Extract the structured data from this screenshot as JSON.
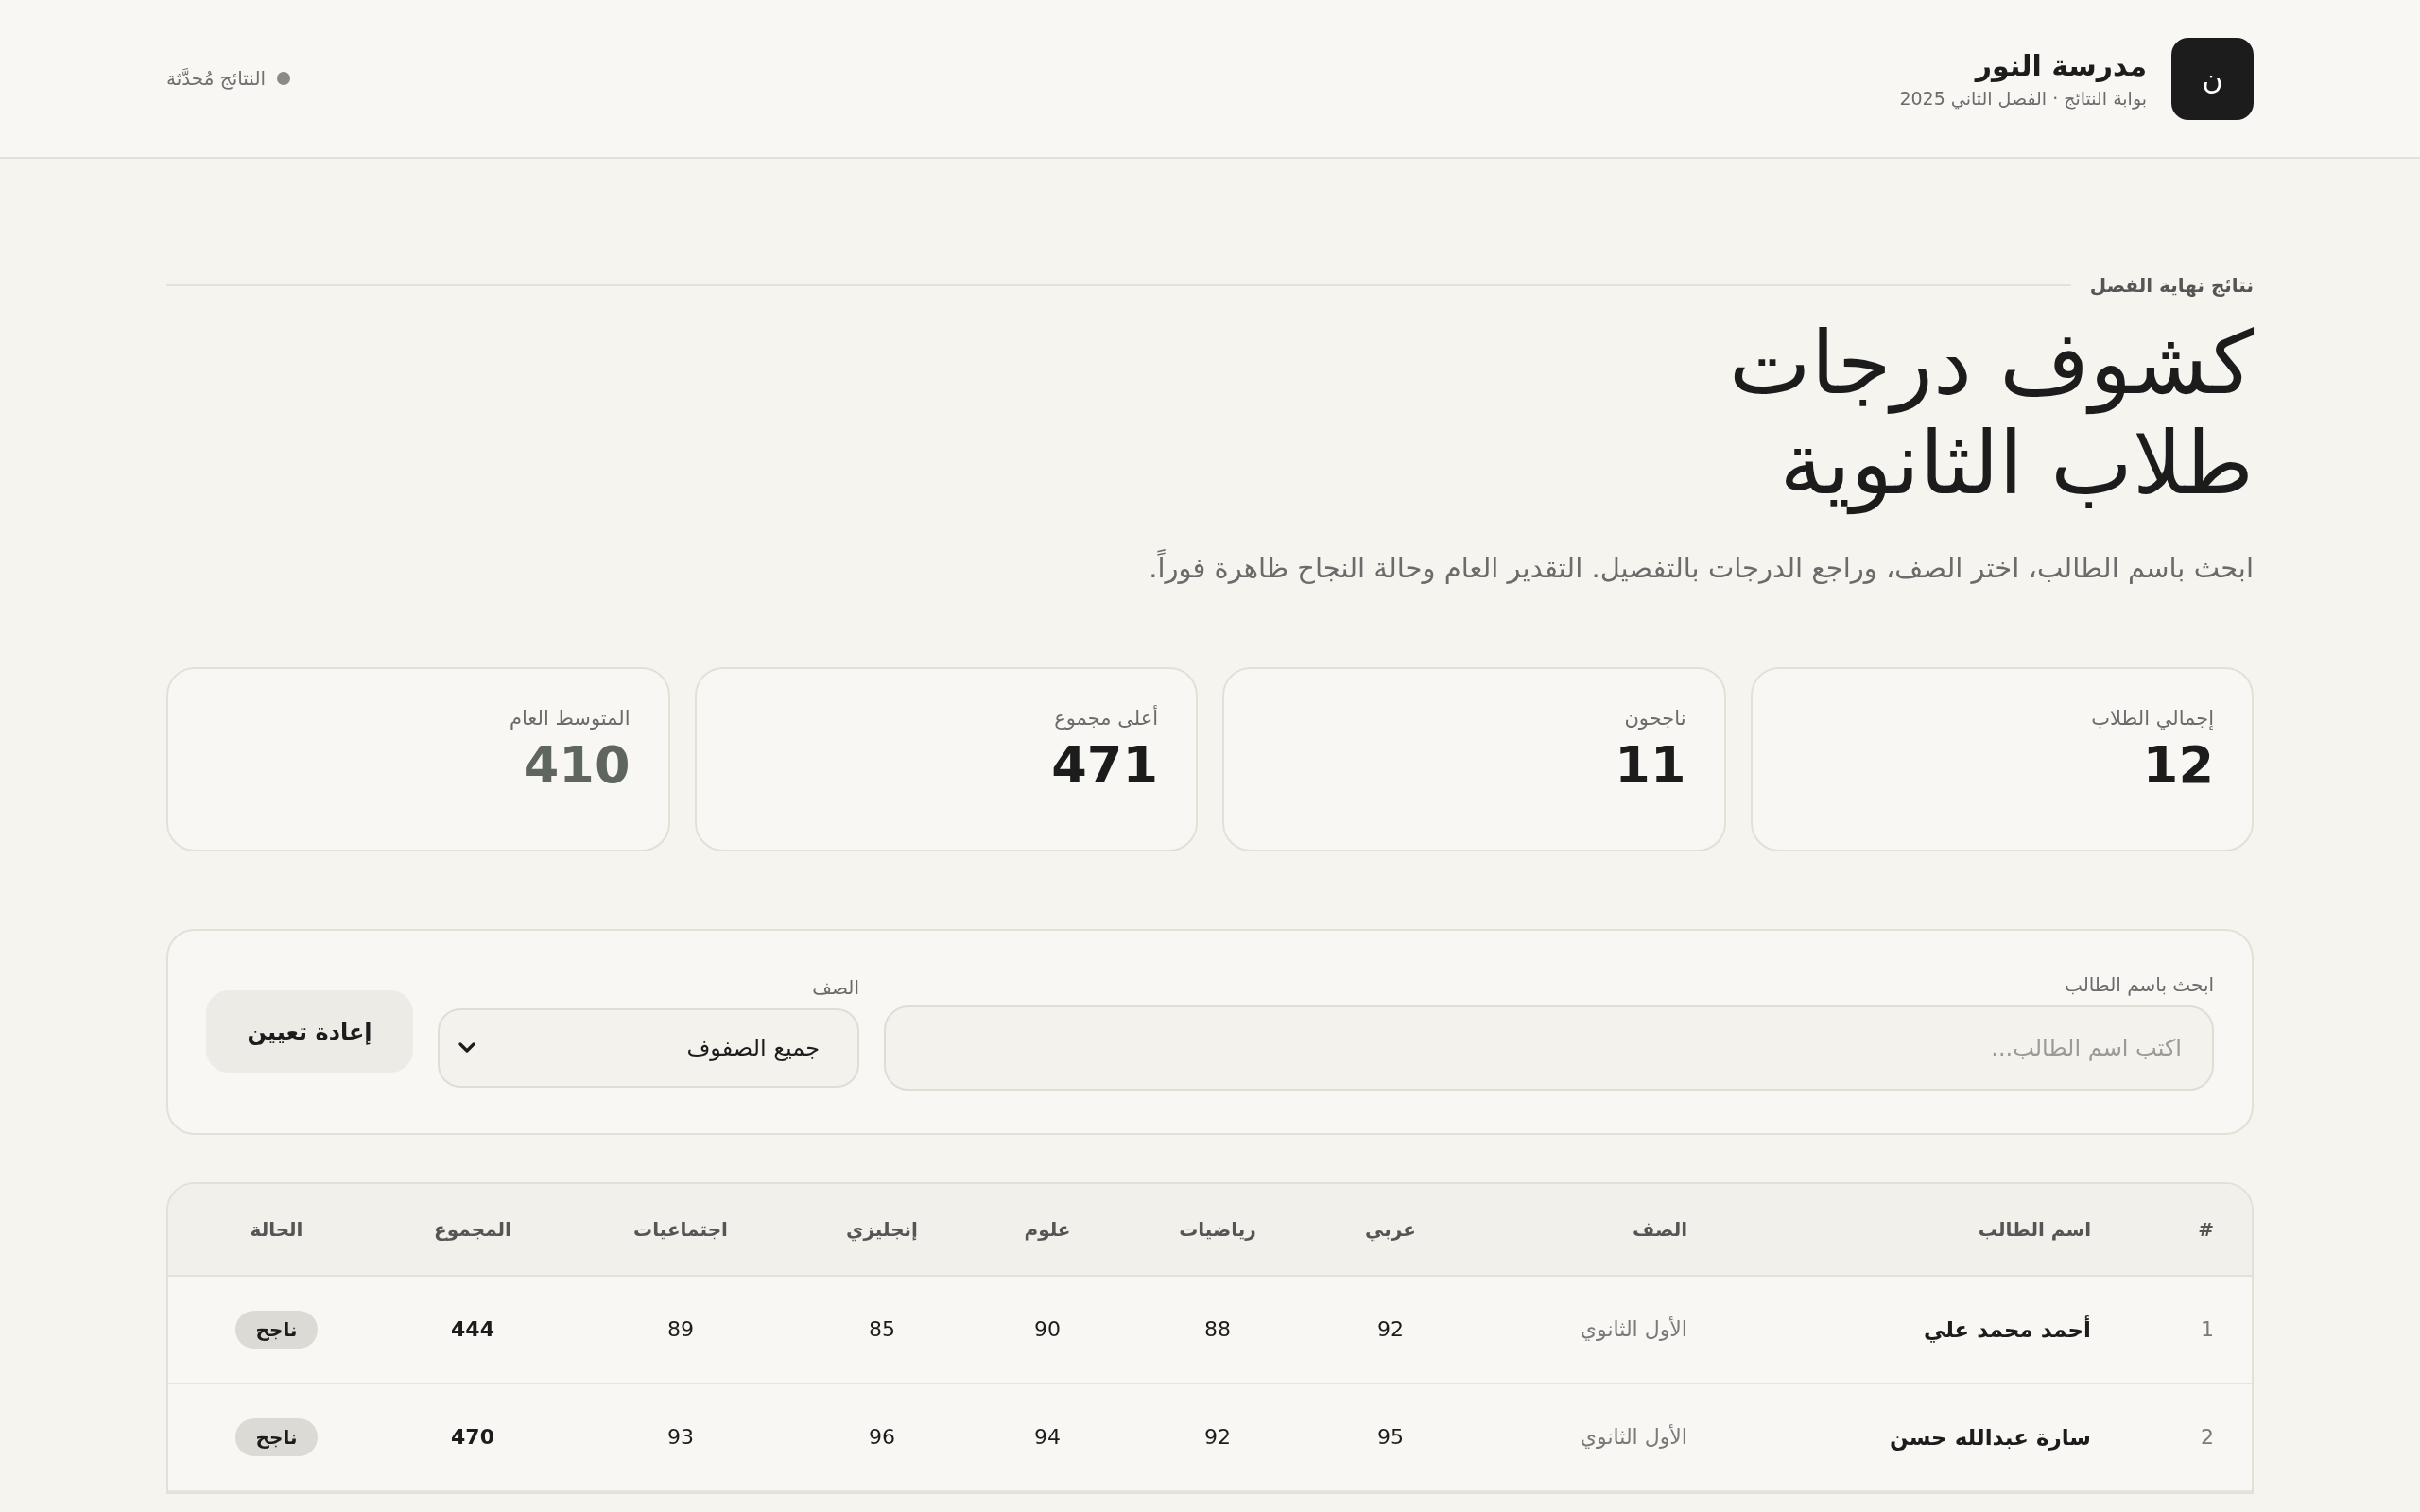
{
  "header": {
    "logo_letter": "ن",
    "school_name": "مدرسة النور",
    "subtitle": "بوابة النتائج · الفصل الثاني 2025",
    "status": "النتائج مُحدَّثة"
  },
  "hero": {
    "eyebrow": "نتائج نهاية الفصل",
    "title_lines": [
      "كشوف درجات",
      "طلاب الثانوية"
    ],
    "description": "ابحث باسم الطالب، اختر الصف، وراجع الدرجات بالتفصيل. التقدير العام وحالة النجاح ظاهرة فوراً."
  },
  "stats": [
    {
      "label": "إجمالي الطلاب",
      "value": "12",
      "color": "#1c1c1c"
    },
    {
      "label": "ناجحون",
      "value": "11",
      "color": "#1c1c1c"
    },
    {
      "label": "أعلى مجموع",
      "value": "471",
      "color": "#1c1c1c"
    },
    {
      "label": "المتوسط العام",
      "value": "410",
      "color": "#5f665f"
    }
  ],
  "filters": {
    "search": {
      "label": "ابحث باسم الطالب",
      "placeholder": "اكتب اسم الطالب..."
    },
    "class_select": {
      "label": "الصف",
      "value": "جميع الصفوف"
    },
    "reset_button": "إعادة تعيين"
  },
  "table": {
    "columns": [
      "#",
      "اسم الطالب",
      "الصف",
      "عربي",
      "رياضيات",
      "علوم",
      "إنجليزي",
      "اجتماعيات",
      "المجموع",
      "الحالة"
    ],
    "rows": [
      {
        "number": "1",
        "name": "أحمد محمد علي",
        "class": "الأول الثانوي",
        "scores": [
          "92",
          "88",
          "90",
          "85",
          "89"
        ],
        "total": "444",
        "status": {
          "label": "ناجح",
          "kind": "pass"
        }
      },
      {
        "number": "2",
        "name": "سارة عبدالله حسن",
        "class": "الأول الثانوي",
        "scores": [
          "95",
          "92",
          "94",
          "96",
          "93"
        ],
        "total": "470",
        "status": {
          "label": "ناجح",
          "kind": "pass"
        }
      }
    ]
  }
}
